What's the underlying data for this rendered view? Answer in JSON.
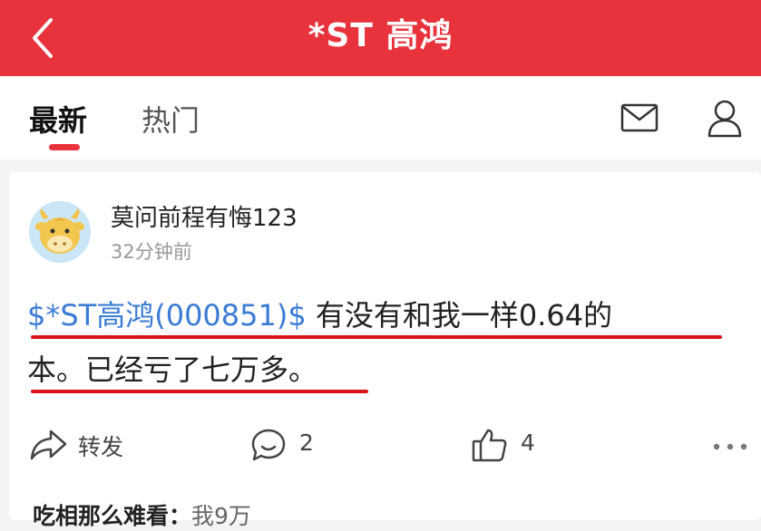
{
  "header": {
    "title": "*ST 高鸿",
    "background_color": "#e8323c",
    "back_icon": "chevron-left-icon"
  },
  "tabs": {
    "items": [
      {
        "label": "最新",
        "active": true
      },
      {
        "label": "热门",
        "active": false
      }
    ],
    "right_icons": [
      "mail-icon",
      "user-icon"
    ]
  },
  "post": {
    "author": "莫问前程有悔123",
    "time": "32分钟前",
    "stock_tag": "$*ST高鸿(000851)$",
    "text_line1": " 有没有和我一样0.64的",
    "text_line2": "本。已经亏了七万多。",
    "highlight_color": "#d7141a",
    "link_color": "#3a7bd5"
  },
  "actions": {
    "share_label": "转发",
    "comment_count": "2",
    "like_count": "4"
  },
  "comment_preview": {
    "author": "吃相那么难看：",
    "text": "我9万"
  }
}
